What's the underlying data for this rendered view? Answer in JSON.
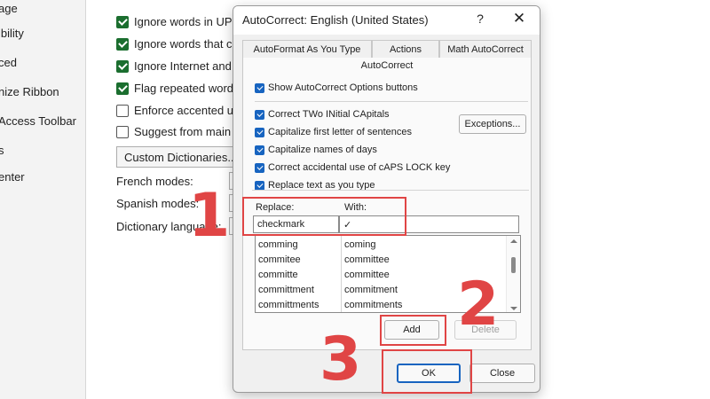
{
  "leftnav": {
    "items": [
      "age",
      "ibility",
      "ced",
      "nize Ribbon",
      "Access Toolbar",
      "s",
      "enter"
    ]
  },
  "bg_options": {
    "checkboxes": [
      {
        "label": "Ignore words in UPP",
        "checked": true
      },
      {
        "label": "Ignore words that co",
        "checked": true
      },
      {
        "label": "Ignore Internet and f",
        "checked": true
      },
      {
        "label": "Flag repeated words",
        "checked": true
      },
      {
        "label": "Enforce accented up",
        "checked": false
      },
      {
        "label": "Suggest from main d",
        "checked": false
      }
    ],
    "custom_dict_button": "Custom Dictionaries...",
    "french_modes": "French modes:",
    "spanish_modes": "Spanish modes:",
    "dictionary_language": "Dictionary language:"
  },
  "dialog": {
    "title": "AutoCorrect: English (United States)",
    "help_glyph": "?",
    "close_glyph": "✕",
    "tabs": [
      "AutoFormat As You Type",
      "Actions",
      "Math AutoCorrect"
    ],
    "active_tab": "AutoCorrect",
    "show_options": "Show AutoCorrect Options buttons",
    "options": [
      "Correct TWo INitial CApitals",
      "Capitalize first letter of sentences",
      "Capitalize names of days",
      "Correct accidental use of cAPS LOCK key",
      "Replace text as you type"
    ],
    "exceptions_button": "Exceptions...",
    "replace_label": "Replace:",
    "with_label": "With:",
    "replace_value": "checkmark",
    "with_value": "✓",
    "list": [
      {
        "replace": "comming",
        "with": "coming"
      },
      {
        "replace": "commitee",
        "with": "committee"
      },
      {
        "replace": "committe",
        "with": "committee"
      },
      {
        "replace": "committment",
        "with": "commitment"
      },
      {
        "replace": "committments",
        "with": "commitments"
      }
    ],
    "add_button": "Add",
    "delete_button": "Delete",
    "ok_button": "OK",
    "close_button": "Close"
  },
  "annotations": {
    "step1": "1",
    "step2": "2",
    "step3": "3"
  },
  "colors": {
    "annotation_red": "#e04545",
    "checkbox_blue": "#1764c0",
    "checkbox_green": "#1b6e2f"
  }
}
